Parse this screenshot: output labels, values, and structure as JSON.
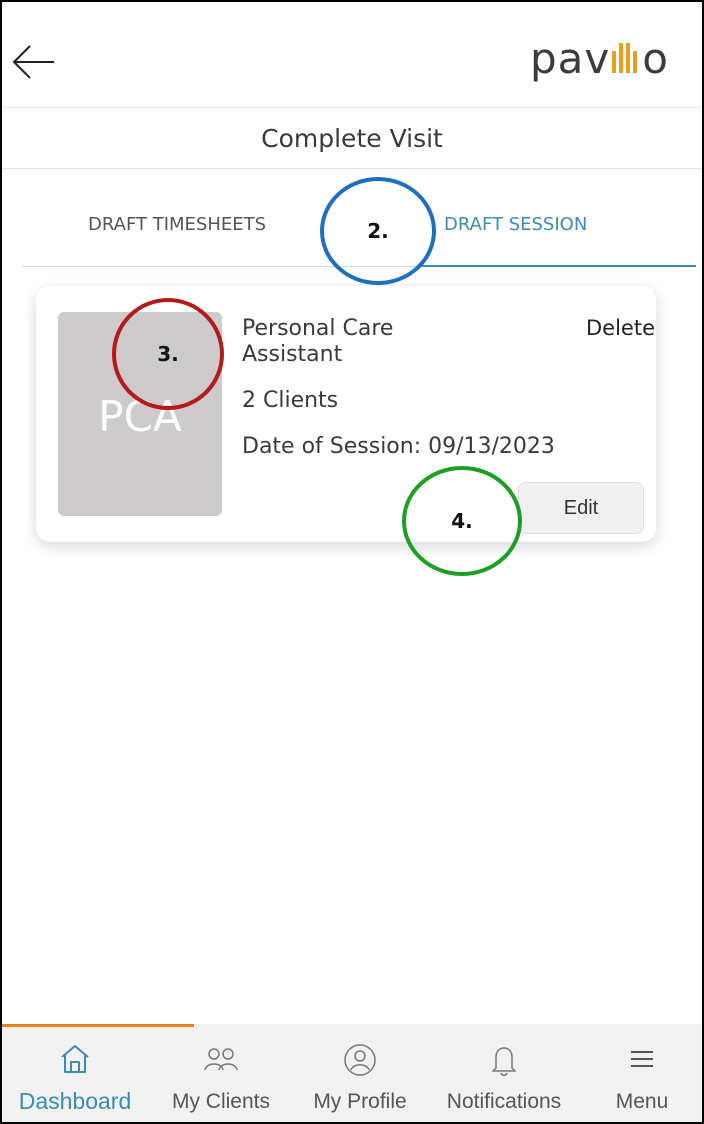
{
  "header": {
    "logo_text_left": "pav",
    "logo_text_right": "o"
  },
  "subheader": {
    "title": "Complete Visit"
  },
  "tabs": [
    {
      "label": "DRAFT TIMESHEETS",
      "active": false
    },
    {
      "label": "DRAFT SESSION",
      "active": true
    }
  ],
  "card": {
    "thumbnail_text": "PCA",
    "title": "Personal Care Assistant",
    "delete_label": "Delete",
    "clients": "2 Clients",
    "date": "Date of Session: 09/13/2023",
    "edit_label": "Edit"
  },
  "annotations": {
    "m2": "2.",
    "m3": "3.",
    "m4": "4."
  },
  "bottom_nav": [
    {
      "label": "Dashboard",
      "icon": "home-icon",
      "active": true
    },
    {
      "label": "My Clients",
      "icon": "clients-icon",
      "active": false
    },
    {
      "label": "My Profile",
      "icon": "profile-icon",
      "active": false
    },
    {
      "label": "Notifications",
      "icon": "bell-icon",
      "active": false
    },
    {
      "label": "Menu",
      "icon": "menu-icon",
      "active": false
    }
  ],
  "colors": {
    "accent": "#3c8bb0",
    "orange": "#e8841f",
    "logo_bars": "#e8a020"
  }
}
